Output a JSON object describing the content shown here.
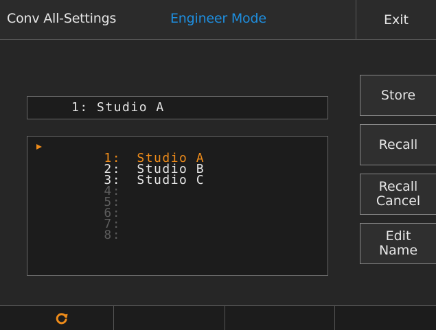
{
  "header": {
    "title": "Conv All-Settings",
    "mode": "Engineer Mode",
    "exit_label": "Exit"
  },
  "selected": {
    "text": "1: Studio A"
  },
  "presets": [
    {
      "num": "1:",
      "name": "Studio A",
      "state": "current"
    },
    {
      "num": "2:",
      "name": "Studio B",
      "state": "used"
    },
    {
      "num": "3:",
      "name": "Studio C",
      "state": "used"
    },
    {
      "num": "4:",
      "name": "",
      "state": "empty"
    },
    {
      "num": "5:",
      "name": "",
      "state": "empty"
    },
    {
      "num": "6:",
      "name": "",
      "state": "empty"
    },
    {
      "num": "7:",
      "name": "",
      "state": "empty"
    },
    {
      "num": "8:",
      "name": "",
      "state": "empty"
    }
  ],
  "side_buttons": {
    "store": "Store",
    "recall": "Recall",
    "recall_cancel": "Recall\nCancel",
    "edit_name": "Edit\nName"
  },
  "bottom": {
    "icon": "refresh-icon"
  },
  "colors": {
    "accent_blue": "#1e8fe0",
    "accent_orange": "#ef8c1a",
    "background": "#262626"
  }
}
